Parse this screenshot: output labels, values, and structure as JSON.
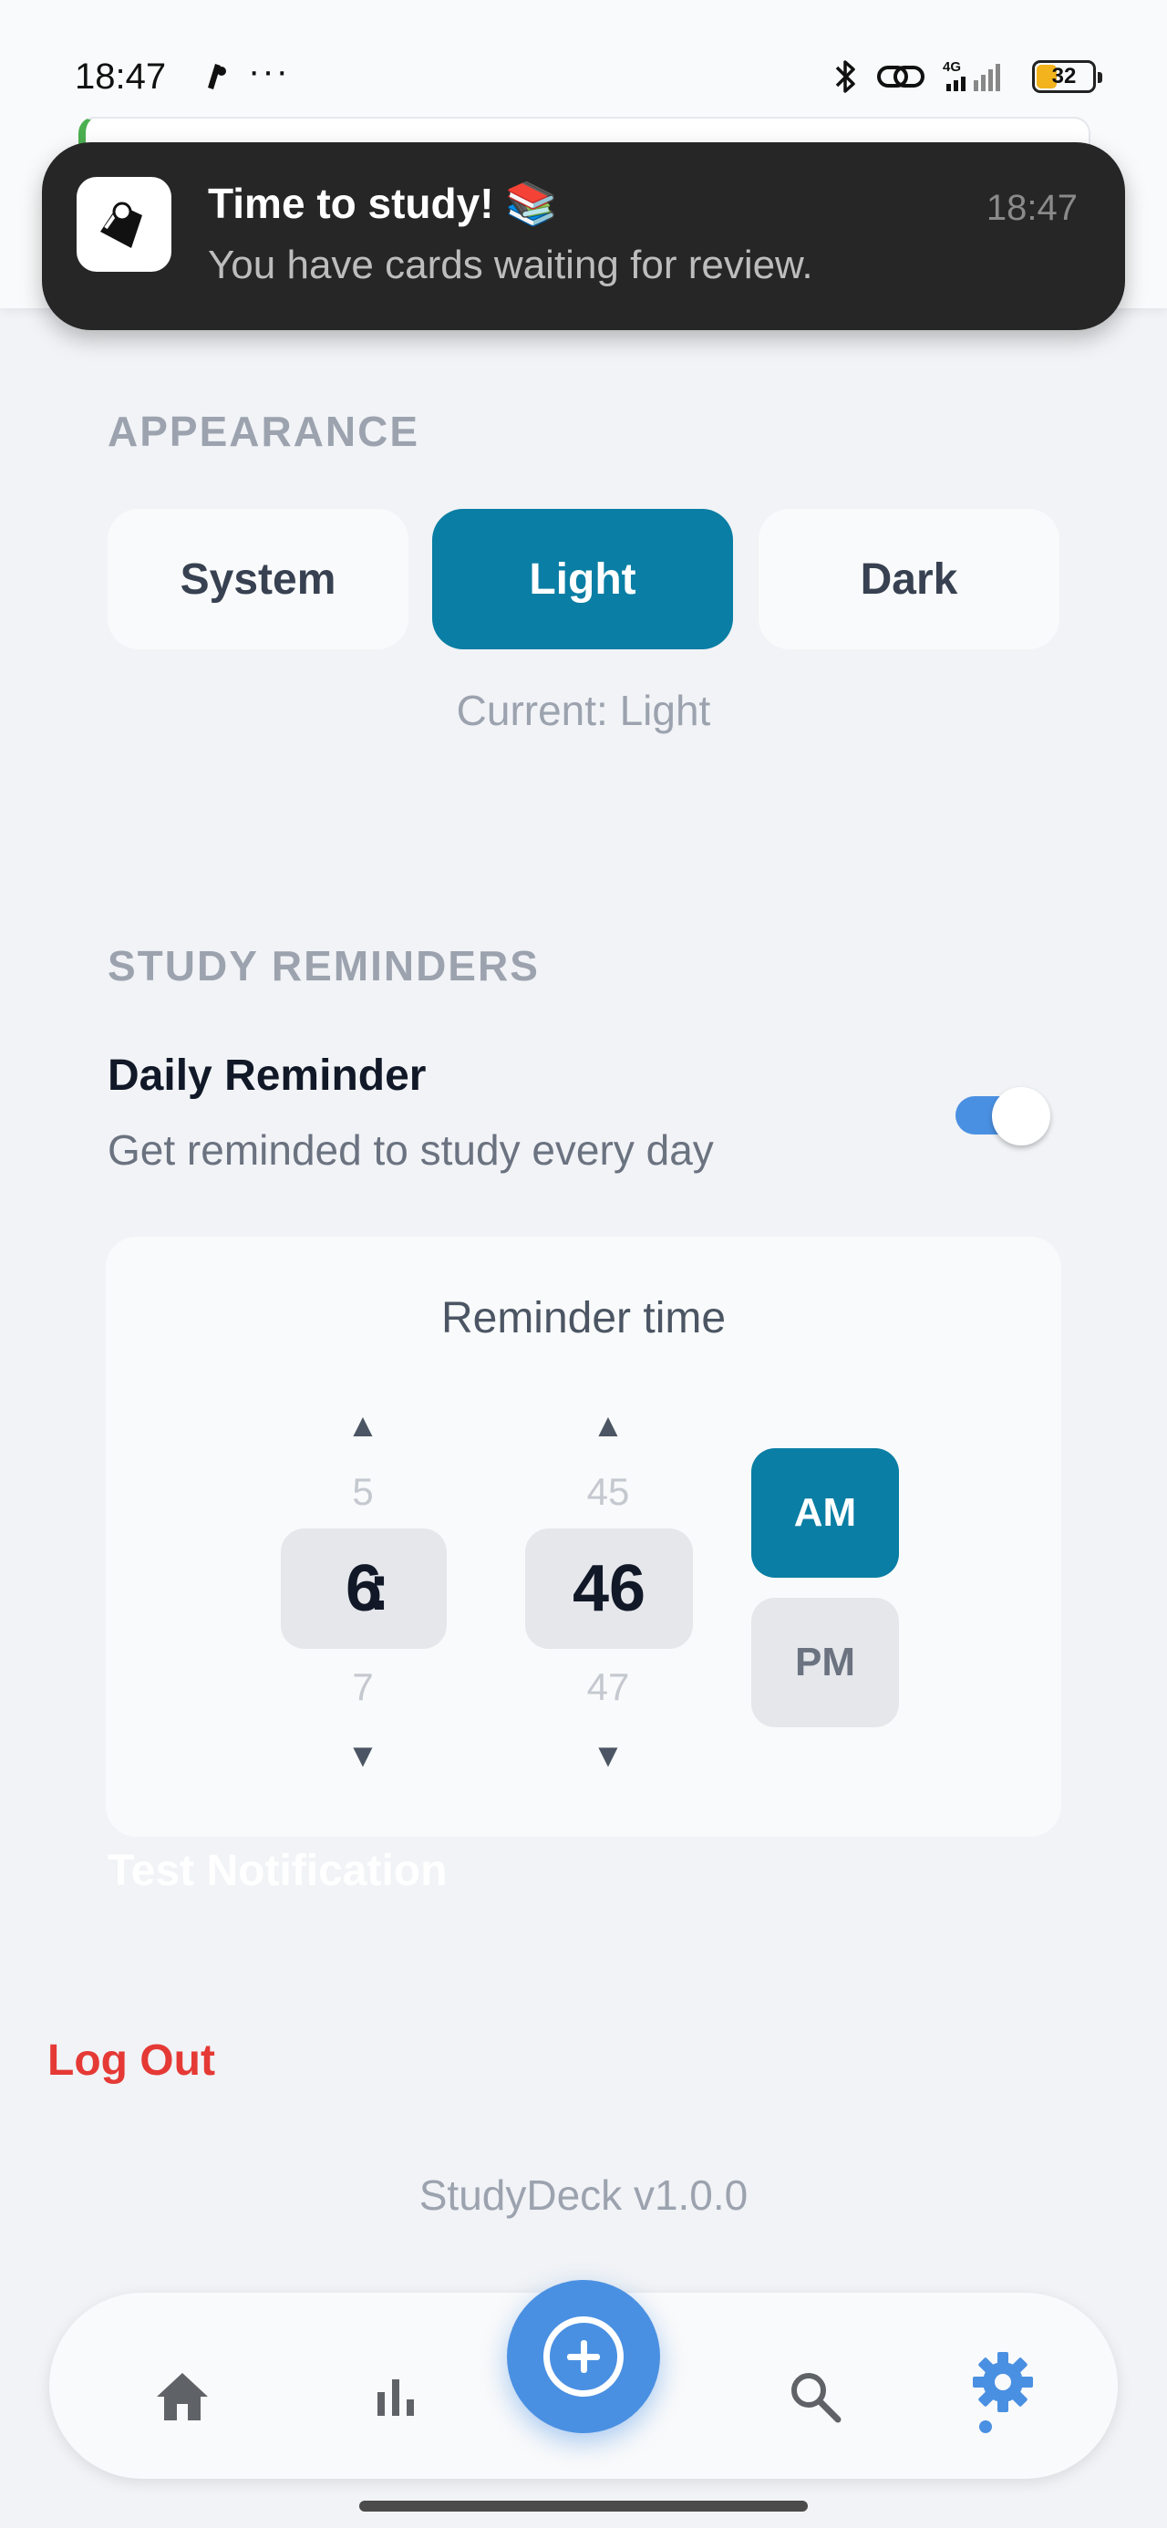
{
  "status_bar": {
    "time": "18:47",
    "more": "···",
    "network": "4G",
    "battery": "32"
  },
  "notification": {
    "title": "Time to study! 📚",
    "body": "You have cards waiting for review.",
    "time": "18:47"
  },
  "appearance": {
    "section_title": "APPEARANCE",
    "options": [
      "System",
      "Light",
      "Dark"
    ],
    "selected": "Light",
    "current_label": "Current: Light"
  },
  "study_reminders": {
    "section_title": "STUDY REMINDERS",
    "daily_title": "Daily Reminder",
    "daily_subtitle": "Get reminded to study every day",
    "enabled": true,
    "time_card_title": "Reminder time",
    "hour": {
      "prev": "5",
      "value": "6",
      "next": "7"
    },
    "separator": ":",
    "minute": {
      "prev": "45",
      "value": "46",
      "next": "47"
    },
    "up_arrow": "▲",
    "down_arrow": "▼",
    "am_label": "AM",
    "pm_label": "PM",
    "selected_period": "AM",
    "test_label": "Test Notification"
  },
  "logout_label": "Log Out",
  "version": "StudyDeck v1.0.0",
  "nav": {
    "items": [
      "home-icon",
      "stats-icon",
      "add-icon",
      "search-icon",
      "settings-icon"
    ],
    "active": "settings-icon"
  },
  "colors": {
    "accent": "#0a7ea4",
    "fab": "#4a90e2",
    "danger": "#e53935",
    "background": "#f1f3f6"
  }
}
